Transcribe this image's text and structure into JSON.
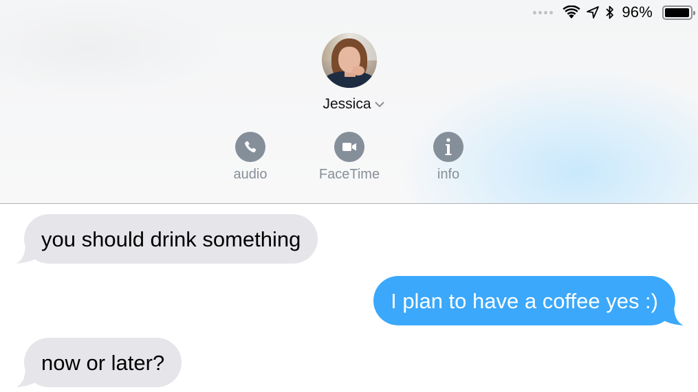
{
  "status_bar": {
    "signal_dots": 4,
    "wifi_icon": "wifi-icon",
    "location_icon": "location-arrow-icon",
    "bluetooth_icon": "bluetooth-icon",
    "battery_percent": "96%",
    "battery_level": 0.96
  },
  "contact": {
    "name": "Jessica",
    "avatar_icon": "contact-photo",
    "expand_icon": "chevron-down-icon"
  },
  "actions": [
    {
      "label": "audio",
      "icon": "phone-icon"
    },
    {
      "label": "FaceTime",
      "icon": "video-camera-icon"
    },
    {
      "label": "info",
      "icon": "info-icon"
    }
  ],
  "messages": [
    {
      "direction": "incoming",
      "text": "you should drink something"
    },
    {
      "direction": "outgoing",
      "text": "I plan to have a coffee yes :)"
    },
    {
      "direction": "incoming",
      "text": "now or later?"
    }
  ],
  "colors": {
    "outgoing_bubble": "#3ba8fb",
    "incoming_bubble": "#e5e5ea",
    "action_icon": "#858f9a"
  }
}
